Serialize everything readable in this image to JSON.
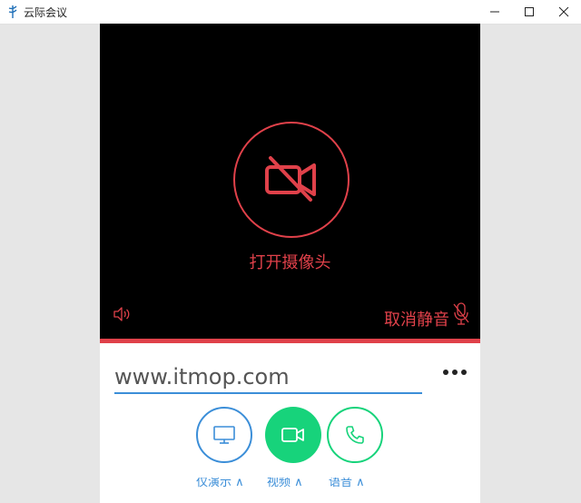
{
  "window": {
    "title": "云际会议",
    "controls": [
      "minimize",
      "maximize",
      "close"
    ]
  },
  "video": {
    "camera_label": "打开摄像头",
    "unmute_label": "取消静音",
    "icons": [
      "camera-off-icon",
      "speaker-icon",
      "mic-off-icon"
    ]
  },
  "meeting": {
    "input_value": "www.itmop.com",
    "more_label": "•••"
  },
  "actions": {
    "buttons": [
      "screen-share",
      "video-call",
      "voice-call"
    ],
    "labels": [
      "仅演示 ∧",
      "视频 ∧",
      "语音 ∧"
    ]
  },
  "colors": {
    "accent_red": "#e0414a",
    "accent_blue": "#3b8ed8",
    "accent_green": "#17d37b"
  }
}
